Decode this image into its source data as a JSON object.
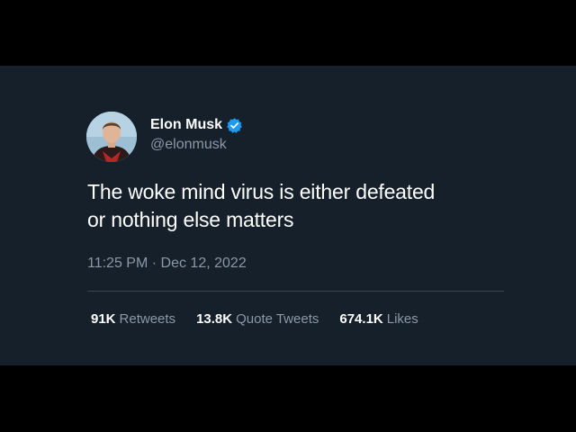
{
  "tweet": {
    "author": {
      "display_name": "Elon Musk",
      "handle": "@elonmusk",
      "verified": true,
      "avatar_icon": "profile-photo"
    },
    "text_lines": [
      "The woke mind virus is either defeated",
      "or nothing else matters"
    ],
    "time": "11:25 PM",
    "separator": "·",
    "date": "Dec 12, 2022",
    "stats": {
      "retweets": {
        "count": "91K",
        "label": "Retweets"
      },
      "quote_tweets": {
        "count": "13.8K",
        "label": "Quote Tweets"
      },
      "likes": {
        "count": "674.1K",
        "label": "Likes"
      }
    }
  },
  "colors": {
    "background": "#15202b",
    "letterbox": "#000000",
    "primary_text": "#ffffff",
    "secondary_text": "#8b98a5",
    "verified_badge": "#1d9bf0",
    "divider": "#38444d"
  }
}
